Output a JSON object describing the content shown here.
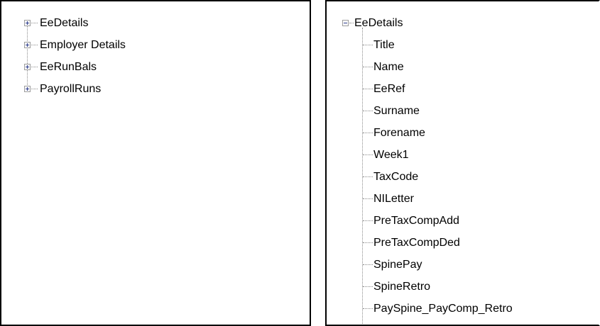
{
  "left_tree": {
    "nodes": [
      {
        "label": "EeDetails",
        "expanded": false
      },
      {
        "label": "Employer Details",
        "expanded": false
      },
      {
        "label": "EeRunBals",
        "expanded": false
      },
      {
        "label": "PayrollRuns",
        "expanded": false
      }
    ]
  },
  "right_tree": {
    "root": {
      "label": "EeDetails",
      "expanded": true
    },
    "children": [
      "Title",
      "Name",
      "EeRef",
      "Surname",
      "Forename",
      "Week1",
      "TaxCode",
      "NILetter",
      "PreTaxCompAdd",
      "PreTaxCompDed",
      "SpinePay",
      "SpineRetro",
      "PaySpine_PayComp_Retro"
    ]
  }
}
